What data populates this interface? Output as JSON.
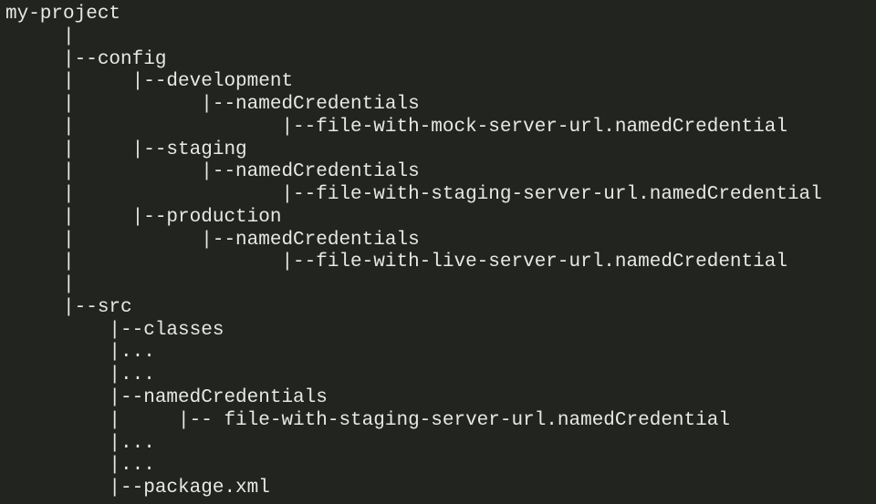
{
  "tree": {
    "l01": "my-project",
    "l02": "     |",
    "l03": "     |--config",
    "l04": "     |     |--development",
    "l05": "     |           |--namedCredentials",
    "l06": "     |                  |--file-with-mock-server-url.namedCredential",
    "l07": "     |     |--staging",
    "l08": "     |           |--namedCredentials",
    "l09": "     |                  |--file-with-staging-server-url.namedCredential",
    "l10": "     |     |--production",
    "l11": "     |           |--namedCredentials",
    "l12": "     |                  |--file-with-live-server-url.namedCredential",
    "l13": "     |",
    "l14": "     |--src",
    "l15": "         |--classes",
    "l16": "         |...",
    "l17": "         |...",
    "l18": "         |--namedCredentials",
    "l19": "         |     |-- file-with-staging-server-url.namedCredential",
    "l20": "         |...",
    "l21": "         |...",
    "l22": "         |--package.xml"
  }
}
